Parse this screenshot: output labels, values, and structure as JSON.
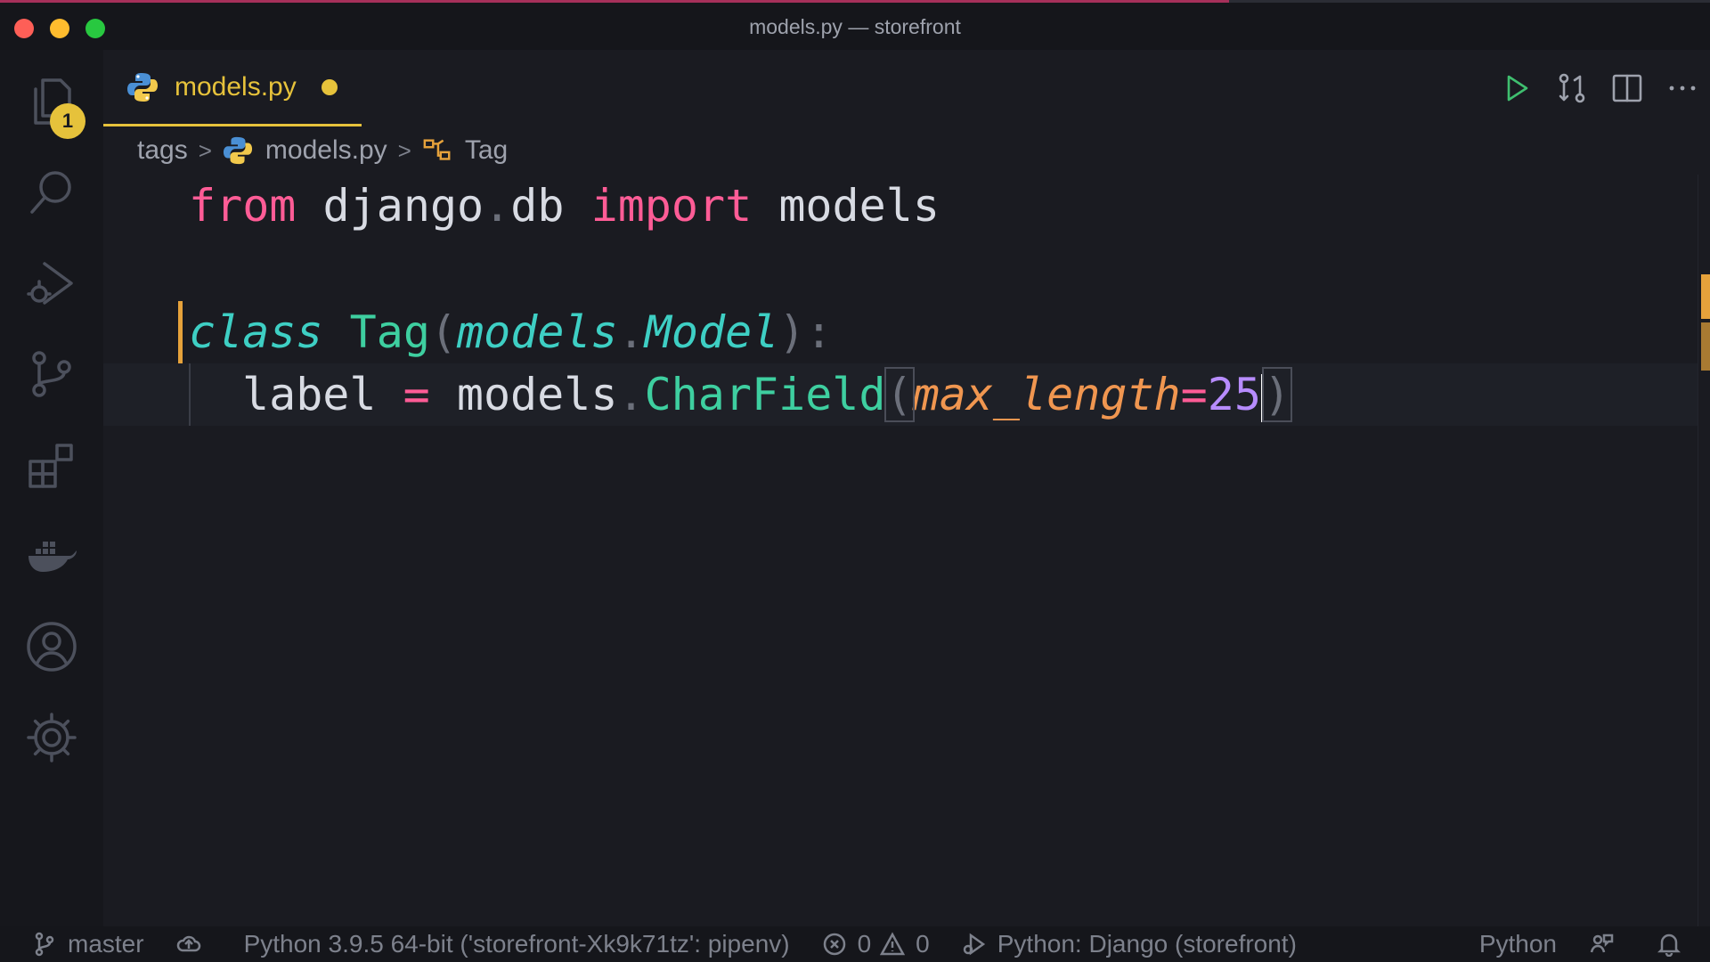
{
  "window": {
    "title": "models.py — storefront"
  },
  "activity_bar": {
    "explorer_badge": "1"
  },
  "tab": {
    "label": "models.py"
  },
  "breadcrumb": {
    "folder": "tags",
    "file": "models.py",
    "symbol": "Tag"
  },
  "code": {
    "line1": {
      "kw1": "from",
      "mod1": "django",
      "dot": ".",
      "mod2": "db",
      "kw2": "import",
      "mod3": "models"
    },
    "line3": {
      "kw": "class",
      "name": "Tag",
      "open": "(",
      "base1": "models",
      "dot": ".",
      "base2": "Model",
      "close": ")",
      "colon": ":"
    },
    "line4": {
      "var": "label",
      "eq": "=",
      "obj": "models",
      "dot": ".",
      "fn": "CharField",
      "open": "(",
      "param": "max_length",
      "peq": "=",
      "num": "25",
      "close": ")"
    }
  },
  "status_bar": {
    "branch": "master",
    "interpreter": "Python 3.9.5 64-bit ('storefront-Xk9k71tz': pipenv)",
    "errors": "0",
    "warnings": "0",
    "debug_config": "Python: Django (storefront)",
    "language": "Python"
  },
  "colors": {
    "accent": "#e6c23b",
    "modified": "#e6a23b",
    "keyword": "#ff5c96",
    "class": "#3ecfc4"
  }
}
